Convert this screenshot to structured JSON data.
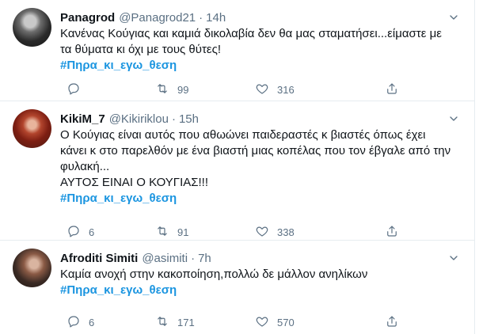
{
  "tweets": [
    {
      "name": "Panagrod",
      "handle": "@Panagrod21",
      "dot": "·",
      "time": "14h",
      "text": "Κανένας Κούγιας και καμιά δικολαβία δεν θα μας σταματήσει...είμαστε με\nτα θύματα κι όχι με τους θύτες!",
      "hashtag": "#Πηρα_κι_εγω_θεση",
      "replies": "",
      "retweets": "99",
      "likes": "316"
    },
    {
      "name": "KikiM_7",
      "handle": "@Kikiriklou",
      "dot": "·",
      "time": "15h",
      "text": "Ο Κούγιας είναι αυτός που αθωώνει παιδεραστές κ βιαστές όπως έχει\nκάνει κ στο παρελθόν με ένα βιαστή μιας κοπέλας που τον έβγαλε από την\nφυλακή...\nΑΥΤΟΣ ΕΙΝΑΙ Ο ΚΟΥΓΙΑΣ!!!",
      "hashtag": "#Πηρα_κι_εγω_θεση",
      "replies": "6",
      "retweets": "91",
      "likes": "338"
    },
    {
      "name": "Afroditi Simiti",
      "handle": "@asimiti",
      "dot": "·",
      "time": "7h",
      "text": "Καμία ανοχή στην κακοποίηση,πολλώ δε μάλλον ανηλίκων",
      "hashtag": "#Πηρα_κι_εγω_θεση",
      "replies": "6",
      "retweets": "171",
      "likes": "570"
    }
  ],
  "icons": {
    "reply": "reply-icon",
    "retweet": "retweet-icon",
    "like": "like-icon",
    "share": "share-icon",
    "more": "chevron-down-icon"
  },
  "colors": {
    "hashtag": "#1b95e0",
    "secondary_text": "#5b7083",
    "divider": "#e6ecf0"
  }
}
